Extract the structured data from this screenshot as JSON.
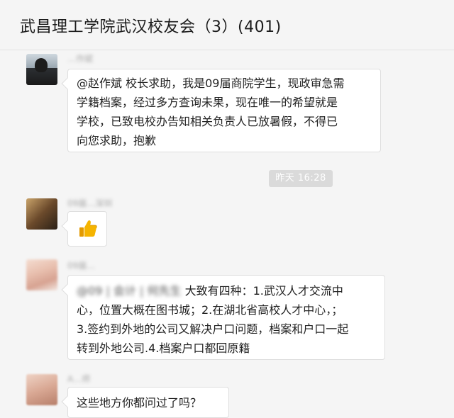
{
  "window": {
    "title": "武昌理工学院武汉校友会（3）(401)"
  },
  "messages": [
    {
      "sender": "…作斌",
      "lines": [
        "@赵作斌 校长求助，我是09届商院学生，现政审急需",
        "学籍档案，经过多方查询未果，现在唯一的希望就是",
        "学校，已致电校办告知相关负责人已放暑假，不得已",
        "向您求助，抱歉"
      ]
    },
    {
      "sender": "09届…深圳",
      "content_icon": "thumbs-up-icon"
    },
    {
      "sender": "09届…",
      "mention": "@09 | 会计 | 何先生",
      "line1_text": "  大致有四种：1.武汉人才交流中",
      "lines": [
        "心，位置大概在图书城；2.在湖北省高校人才中心，；",
        "3.签约到外地的公司又解决户口问题，档案和户口一起",
        "转到外地公司.4.档案户口都回原籍"
      ]
    },
    {
      "sender": "A…师",
      "text": "这些地方你都问过了吗？"
    }
  ],
  "timestamp": "昨天 16:28",
  "colors": {
    "background": "#f5f5f5",
    "bubble": "#ffffff",
    "time_chip": "#dadada",
    "thumb": "#f5b400"
  }
}
